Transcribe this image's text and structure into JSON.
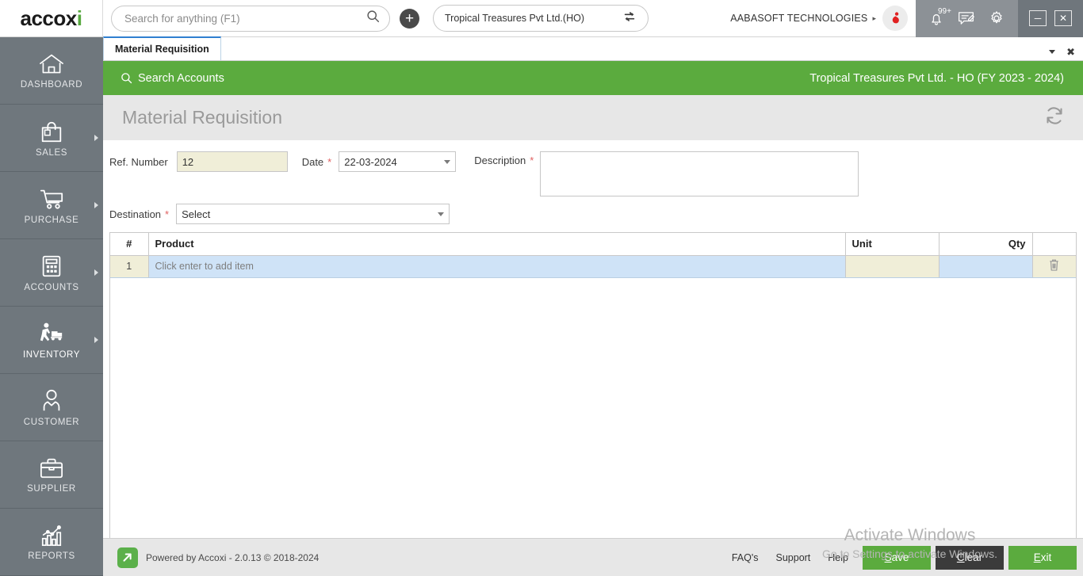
{
  "topbar": {
    "logo_text": "accox",
    "logo_accent_char": "i",
    "search_placeholder": "Search for anything (F1)",
    "search_value": "",
    "search_icon": "search-icon",
    "add_icon": "plus-icon",
    "company_selector": "Tropical Treasures Pvt Ltd.(HO)",
    "switch_icon": "switch-company-icon",
    "user_name": "AABASOFT TECHNOLOGIES",
    "user_caret": "▸",
    "avatar_icon": "user-avatar-icon",
    "notification_badge": "99+",
    "notification_icon": "bell-icon",
    "message_icon": "note-icon",
    "settings_icon": "gear-icon",
    "minimize_label": "─",
    "close_label": "✕"
  },
  "sidebar": {
    "items": [
      {
        "label": "DASHBOARD",
        "icon": "home-icon",
        "has_arrow": false,
        "active": false
      },
      {
        "label": "SALES",
        "icon": "shopping-bag-icon",
        "has_arrow": true,
        "active": false
      },
      {
        "label": "PURCHASE",
        "icon": "shopping-cart-icon",
        "has_arrow": true,
        "active": false
      },
      {
        "label": "ACCOUNTS",
        "icon": "calculator-icon",
        "has_arrow": true,
        "active": false
      },
      {
        "label": "INVENTORY",
        "icon": "warehouse-worker-icon",
        "has_arrow": true,
        "active": true
      },
      {
        "label": "CUSTOMER",
        "icon": "person-icon",
        "has_arrow": false,
        "active": false
      },
      {
        "label": "SUPPLIER",
        "icon": "briefcase-icon",
        "has_arrow": false,
        "active": false
      },
      {
        "label": "REPORTS",
        "icon": "bar-chart-icon",
        "has_arrow": false,
        "active": false
      }
    ]
  },
  "tabstrip": {
    "tab_label": "Material Requisition",
    "dropdown_icon": "chevron-down-icon",
    "close_icon": "close-icon"
  },
  "greenbar": {
    "search_accounts_label": "Search Accounts",
    "search_icon": "search-icon",
    "company_fy": "Tropical Treasures Pvt Ltd. - HO (FY 2023 - 2024)",
    "color": "#5bab3e"
  },
  "titlebar": {
    "title": "Material Requisition",
    "refresh_icon": "refresh-icon"
  },
  "form": {
    "ref_number": {
      "label": "Ref. Number",
      "value": "12",
      "required": false
    },
    "date": {
      "label": "Date",
      "value": "22-03-2024",
      "required": true
    },
    "description": {
      "label": "Description",
      "value": "",
      "required": true
    },
    "destination": {
      "label": "Destination",
      "value": "Select",
      "required": true
    }
  },
  "grid": {
    "columns": [
      "#",
      "Product",
      "Unit",
      "Qty",
      ""
    ],
    "rows": [
      {
        "num": "1",
        "product": "Click enter to add item",
        "unit": "",
        "qty": "",
        "delete_icon": "trash-icon"
      }
    ]
  },
  "watermark": {
    "line1": "Activate Windows",
    "line2": "Go to Settings to activate Windows."
  },
  "footer": {
    "powered_text": "Powered by Accoxi - 2.0.13 © 2018-2024",
    "powered_icon": "accoxi-arrow-icon",
    "links": [
      "FAQ's",
      "Support",
      "Help"
    ],
    "buttons": [
      {
        "label": "Save",
        "accel": "S",
        "style": "green"
      },
      {
        "label": "Clear",
        "accel": "C",
        "style": "dark"
      },
      {
        "label": "Exit",
        "accel": "E",
        "style": "green"
      }
    ]
  },
  "colors": {
    "brand_green": "#5bab3e",
    "sidebar_gray": "#6f777d",
    "field_yellow": "#f0eed8",
    "row_blue": "#cfe3f7",
    "tab_accent_blue": "#2f7fd0"
  }
}
